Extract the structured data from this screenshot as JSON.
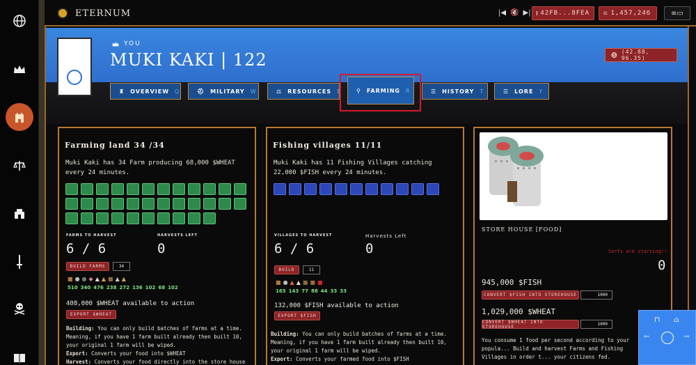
{
  "brand": {
    "name": "ETERNUM"
  },
  "topbar": {
    "wallet": "42FB...8FEA",
    "gold": "1,457,246",
    "media_prev_icon": "skip-back-icon",
    "mute_icon": "speaker-muted-icon",
    "media_next_icon": "skip-forward-icon"
  },
  "sidebar": {
    "items": [
      {
        "icon": "globe-icon",
        "active": false
      },
      {
        "icon": "crown-icon",
        "active": false
      },
      {
        "icon": "castle-icon",
        "active": true
      },
      {
        "icon": "scales-icon",
        "active": false
      },
      {
        "icon": "fortress-icon",
        "active": false
      },
      {
        "icon": "sword-icon",
        "active": false
      },
      {
        "icon": "skull-icon",
        "active": false
      },
      {
        "icon": "book-icon",
        "active": false
      }
    ]
  },
  "profile": {
    "you_label": "YOU",
    "name": "MUKI KAKI | 122",
    "coords": "(42.88, 96.35)"
  },
  "tabs": [
    {
      "label": "OVERVIEW",
      "key": "Q"
    },
    {
      "label": "MILITARY",
      "key": "W"
    },
    {
      "label": "RESOURCES",
      "key": "E"
    },
    {
      "label": "FARMING",
      "key": "R"
    },
    {
      "label": "HISTORY",
      "key": "T"
    },
    {
      "label": "LORE",
      "key": "Y"
    }
  ],
  "farming": {
    "title": "Farming land 34 /34",
    "desc": "Muki Kaki has 34 Farm producing 68,000 $WHEAT every 24 minutes.",
    "count": 34,
    "harvest_label": "FARMS TO HARVEST",
    "harvest_value": "6 / 6",
    "left_label": "HARVESTS LEFT",
    "left_value": "0",
    "build_label": "BUILD FARMS",
    "build_qty": "34",
    "res_values": [
      "510",
      "340",
      "476",
      "238",
      "272",
      "136",
      "102",
      "68",
      "102"
    ],
    "available": "408,000 $WHEAT available to action",
    "export_label": "EXPORT $WHEAT",
    "building_label": "Building:",
    "building_text": "You can only build batches of farms at a time. Meaning, if you have 1 farm built already then built 10, your original 1 farm will be wiped.",
    "export_info_label": "Export:",
    "export_info_text": "Converts your food into $WHEAT",
    "harvest_info_label": "Harvest:",
    "harvest_info_text": "Converts your food directly into the store house for"
  },
  "fishing": {
    "title": "Fishing villages 11/11",
    "desc": "Muki Kaki has 11 Fishing Villages catching 22,000 $FISH every 24 minutes.",
    "count": 11,
    "harvest_label": "VILLAGES TO HARVEST",
    "harvest_value": "6 / 6",
    "left_label": "Harvests Left",
    "left_value": "0",
    "build_label": "BUILD",
    "build_qty": "11",
    "res_values": [
      "165",
      "143",
      "77",
      "88",
      "44",
      "33",
      "33"
    ],
    "available": "132,000 $FISH available to action",
    "export_label": "EXPORT $FISH",
    "building_label": "Building:",
    "building_text": "You can only build batches of farms at a time. Meaning, if you have 1 farm built already then built 10, your original 1 farm will be wiped.",
    "export_info_label": "Export:",
    "export_info_text": "Converts your farmed food into $FISH"
  },
  "storehouse": {
    "title": "STORE HOUSE [FOOD]",
    "starving": "Serfs are starving!!",
    "count": "0",
    "fish_amount": "945,000 $FISH",
    "fish_convert": "CONVERT $FISH INTO STOREHOUSE",
    "fish_qty": "1000",
    "wheat_amount": "1,029,000 $WHEAT",
    "wheat_convert": "CONVERT $WHEAT INTO STOREHOUSE",
    "wheat_qty": "1000",
    "desc": "You consume 1 food per second according to your popula... Build and harvest Farms and Fishing Villages in order t... your citizens fed."
  },
  "colors": {
    "accent": "#3a86df",
    "danger": "#8e2427",
    "frame": "#b87a34",
    "farm": "#2d8a4a",
    "fish": "#2b47b8"
  }
}
